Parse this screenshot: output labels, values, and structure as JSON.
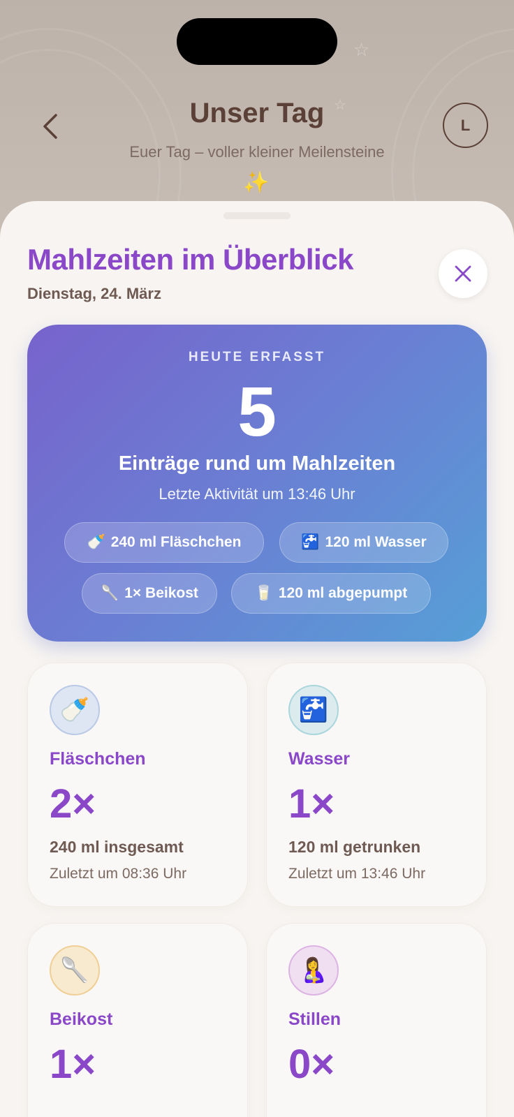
{
  "header": {
    "title": "Unser Tag",
    "subtitle": "Euer Tag – voller kleiner Meilensteine",
    "avatar_initial": "L"
  },
  "sheet": {
    "title": "Mahlzeiten im Überblick",
    "date": "Dienstag, 24. März"
  },
  "summary": {
    "kicker": "HEUTE ERFASST",
    "count": "5",
    "label": "Einträge rund um Mahlzeiten",
    "last_activity": "Letzte Aktivität um 13:46 Uhr",
    "chips": [
      {
        "icon": "🍼",
        "label": "240 ml Fläschchen"
      },
      {
        "icon": "🚰",
        "label": "120 ml Wasser"
      },
      {
        "icon": "🥄",
        "label": "1× Beikost"
      },
      {
        "icon": "🥛",
        "label": "120 ml abgepumpt"
      }
    ]
  },
  "cards": [
    {
      "icon": "🍼",
      "icon_bg": "#dfe6f3",
      "icon_border": "#b9c9e6",
      "title": "Fläschchen",
      "count": "2×",
      "amount": "240 ml insgesamt",
      "last": "Zuletzt um 08:36 Uhr"
    },
    {
      "icon": "🚰",
      "icon_bg": "#dcecee",
      "icon_border": "#a9d6dc",
      "title": "Wasser",
      "count": "1×",
      "amount": "120 ml getrunken",
      "last": "Zuletzt um 13:46 Uhr"
    },
    {
      "icon": "🥄",
      "icon_bg": "#f8eacf",
      "icon_border": "#efcf96",
      "title": "Beikost",
      "count": "1×",
      "amount": "",
      "last": ""
    },
    {
      "icon": "🤱",
      "icon_bg": "#efdff1",
      "icon_border": "#dcb4e3",
      "title": "Stillen",
      "count": "0×",
      "amount": "",
      "last": ""
    }
  ],
  "colors": {
    "accent": "#8a48c9",
    "brown": "#5a4036",
    "gradient_start": "#7763cc",
    "gradient_end": "#569fd7"
  }
}
